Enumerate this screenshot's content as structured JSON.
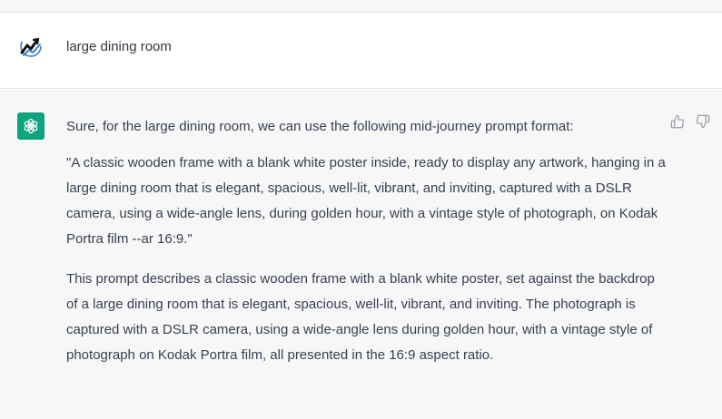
{
  "conversation": {
    "user_message": {
      "avatar": "user-logo-icon",
      "text": "large dining room"
    },
    "assistant_message": {
      "avatar": "openai-logo-icon",
      "avatar_color": "#10a37f",
      "paragraphs": [
        "Sure, for the large dining room, we can use the following mid-journey prompt format:",
        "\"A classic wooden frame with a blank white poster inside, ready to display any artwork, hanging in a large dining room that is elegant, spacious, well-lit, vibrant, and inviting, captured with a DSLR camera, using a wide-angle lens, during golden hour, with a vintage style of photograph, on Kodak Portra film --ar 16:9.\"",
        "This prompt describes a classic wooden frame with a blank white poster, set against the backdrop of a large dining room that is elegant, spacious, well-lit, vibrant, and inviting. The photograph is captured with a DSLR camera, using a wide-angle lens during golden hour, with a vintage style of photograph on Kodak Portra film, all presented in the 16:9 aspect ratio."
      ],
      "feedback_icons": [
        "thumbs-up-icon",
        "thumbs-down-icon"
      ]
    }
  }
}
